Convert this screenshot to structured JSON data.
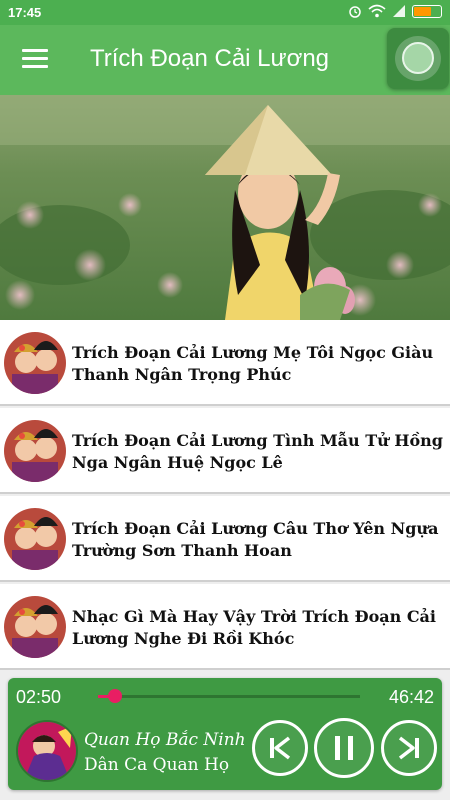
{
  "status_bar": {
    "time": "17:45",
    "icons": [
      "alarm-icon",
      "wifi-icon",
      "signal-icon",
      "battery-icon"
    ],
    "battery_color": "#ff9800"
  },
  "app_bar": {
    "title": "Trích Đoạn Cải Lương",
    "background": "#5cb85c",
    "menu_icon": "hamburger-menu-icon",
    "float_button_icon": "floating-bubble-icon"
  },
  "songs": [
    {
      "title": "Trích Đoạn Cải Lương Mẹ Tôi Ngọc Giàu Thanh Ngân Trọng Phúc",
      "thumb_icon": "cai-luong-thumbnail"
    },
    {
      "title": "Trích Đoạn Cải Lương Tình Mẫu Tử Hồng Nga Ngân Huệ Ngọc Lê",
      "thumb_icon": "cai-luong-thumbnail"
    },
    {
      "title": "Trích Đoạn Cải Lương Câu Thơ Yên Ngựa Trường Sơn Thanh Hoan",
      "thumb_icon": "cai-luong-thumbnail"
    },
    {
      "title": "Nhạc Gì Mà Hay Vậy Trời Trích Đoạn Cải Lương Nghe Đi Rồi Khóc",
      "thumb_icon": "cai-luong-thumbnail"
    }
  ],
  "player": {
    "current_time": "02:50",
    "total_time": "46:42",
    "progress": 0.065,
    "track_title": "Quan Họ Bắc Ninh",
    "track_artist": "Dân Ca Quan Họ",
    "accent_color": "#e91e63",
    "controls": [
      "skip-previous-icon",
      "pause-icon",
      "skip-next-icon"
    ]
  }
}
